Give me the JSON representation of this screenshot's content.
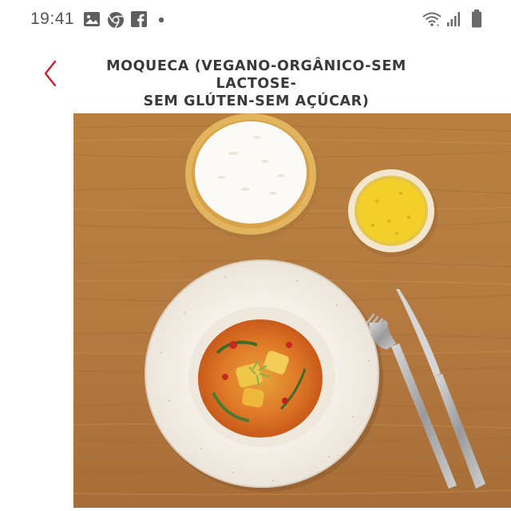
{
  "status_bar": {
    "time": "19:41",
    "icons": [
      "image-icon",
      "chrome-icon",
      "facebook-icon",
      "notification-dot-icon",
      "wifi-icon",
      "signal-icon",
      "battery-icon"
    ]
  },
  "header": {
    "back_icon": "chevron-left-icon",
    "title_line1": "MOQUECA (VEGANO-ORGÂNICO-SEM LACTOSE-",
    "title_line2": "SEM GLÚTEN-SEM AÇÚCAR)"
  },
  "colors": {
    "accent": "#c8202f",
    "title_text": "#3a3a3a",
    "status_text": "#555555",
    "wood": "#b57a44"
  }
}
